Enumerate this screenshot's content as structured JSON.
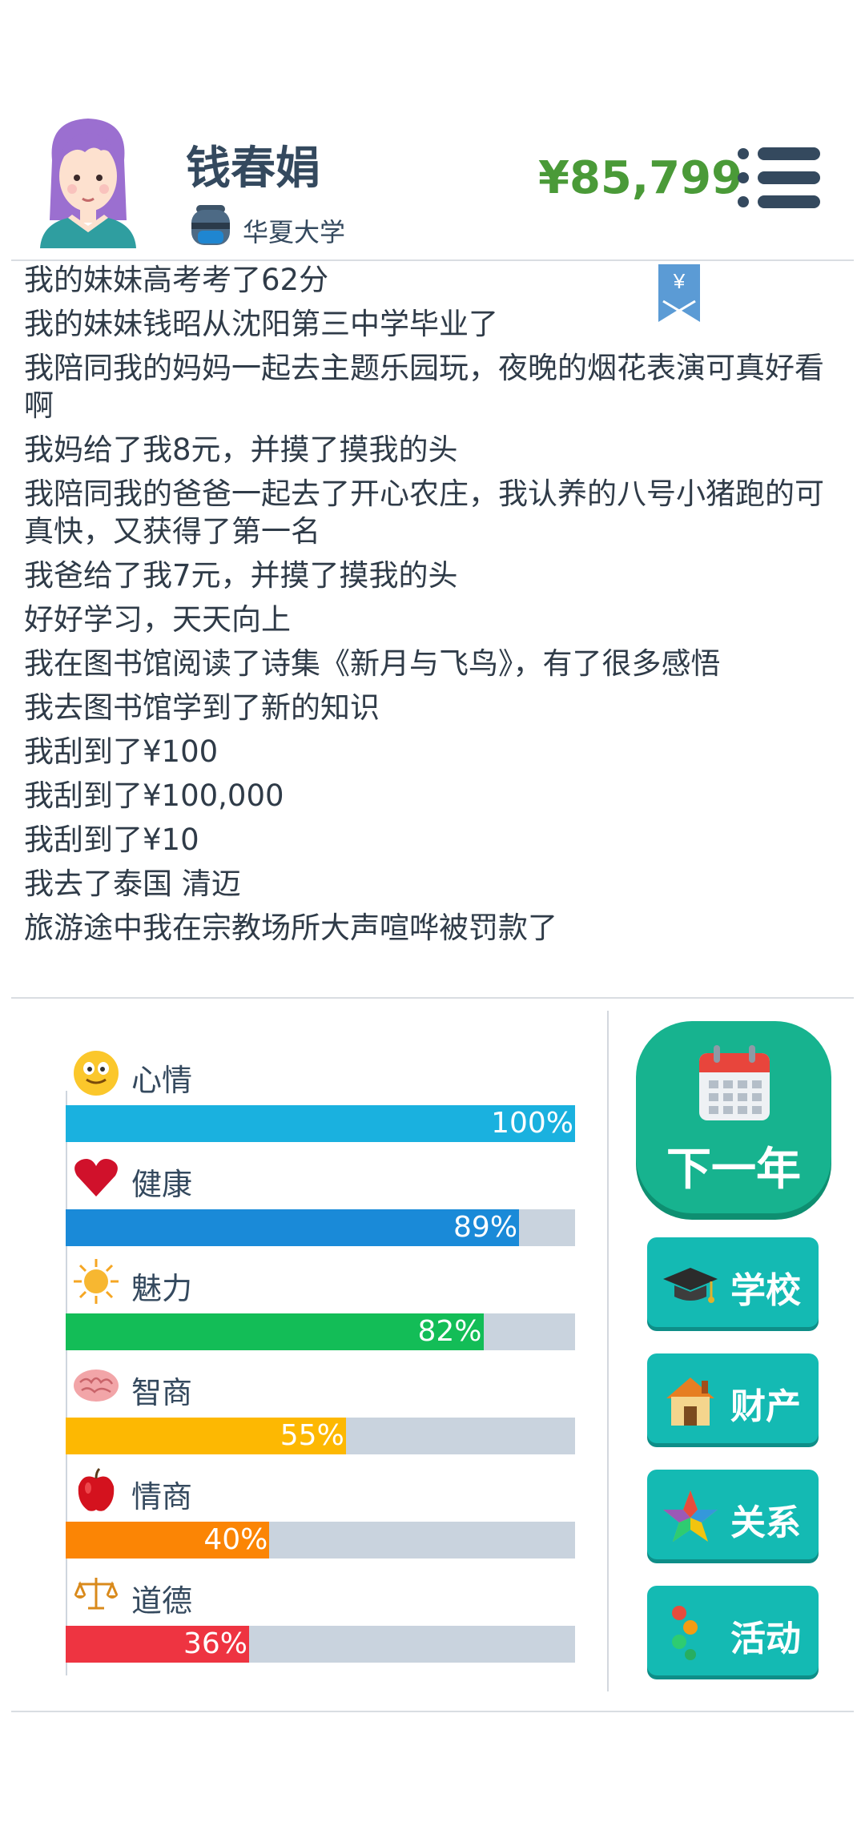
{
  "profile": {
    "name": "钱春娟",
    "school": "华夏大学",
    "money": "¥85,799"
  },
  "log": [
    "我的妹妹高考考了62分",
    "我的妹妹钱昭从沈阳第三中学毕业了",
    "我陪同我的妈妈一起去主题乐园玩，夜晚的烟花表演可真好看啊",
    "我妈给了我8元，并摸了摸我的头",
    "我陪同我的爸爸一起去了开心农庄，我认养的八号小猪跑的可真快，又获得了第一名",
    "我爸给了我7元，并摸了摸我的头",
    "好好学习，天天向上",
    "我在图书馆阅读了诗集《新月与飞鸟》，有了很多感悟",
    "我去图书馆学到了新的知识",
    "我刮到了¥100",
    "我刮到了¥100,000",
    "我刮到了¥10",
    "我去了泰国 清迈",
    "旅游途中我在宗教场所大声喧哗被罚款了"
  ],
  "bookmark_symbol": "¥",
  "stats": [
    {
      "label": "心情",
      "value": 100,
      "value_text": "100%",
      "color": "#1ab1df",
      "icon": "smiley-icon"
    },
    {
      "label": "健康",
      "value": 89,
      "value_text": "89%",
      "color": "#1a8ad8",
      "icon": "heart-icon"
    },
    {
      "label": "魅力",
      "value": 82,
      "value_text": "82%",
      "color": "#13bd57",
      "icon": "sun-icon"
    },
    {
      "label": "智商",
      "value": 55,
      "value_text": "55%",
      "color": "#fdb802",
      "icon": "brain-icon"
    },
    {
      "label": "情商",
      "value": 40,
      "value_text": "40%",
      "color": "#fb8505",
      "icon": "apple-icon"
    },
    {
      "label": "道德",
      "value": 36,
      "value_text": "36%",
      "color": "#ee3441",
      "icon": "scales-icon"
    }
  ],
  "actions": {
    "next_year": "下一年",
    "school": "学校",
    "property": "财产",
    "relations": "关系",
    "activities": "活动"
  }
}
